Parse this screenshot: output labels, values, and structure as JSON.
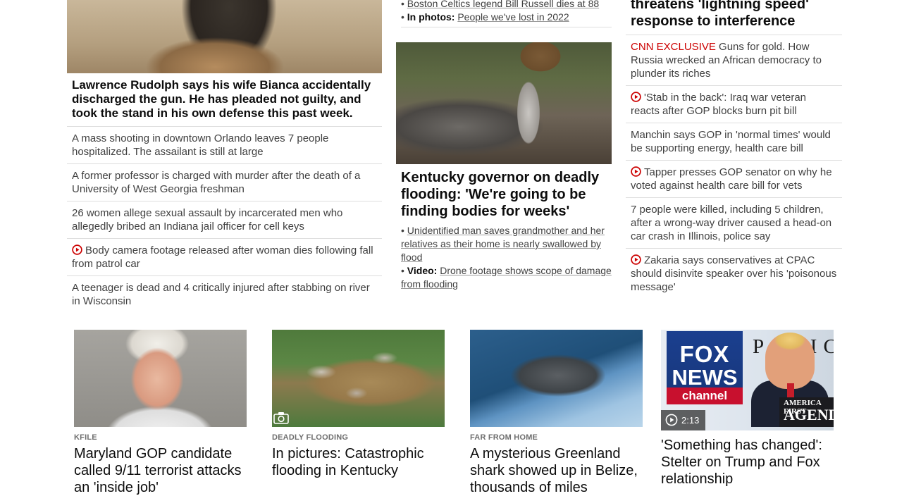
{
  "col1": {
    "lead_caption": "Lawrence Rudolph says his wife Bianca accidentally discharged the gun. He has pleaded not guilty, and took the stand in his own defense this past week.",
    "items": [
      {
        "text": "A mass shooting in downtown Orlando leaves 7 people hospitalized. The assailant is still at large",
        "video": false
      },
      {
        "text": "A former professor is charged with murder after the death of a University of West Georgia freshman",
        "video": false
      },
      {
        "text": "26 women allege sexual assault by incarcerated men who allegedly bribed an Indiana jail officer for cell keys",
        "video": false
      },
      {
        "text": "Body camera footage released after woman dies following fall from patrol car",
        "video": true
      },
      {
        "text": "A teenager is dead and 4 critically injured after stabbing on river in Wisconsin",
        "video": false
      }
    ]
  },
  "col2": {
    "top_bullets": [
      {
        "prefix": "",
        "text": "Boston Celtics legend Bill Russell dies at 88"
      },
      {
        "prefix": "In photos:",
        "text": "People we've lost in 2022"
      }
    ],
    "headline": "Kentucky governor on deadly flooding: 'We're going to be finding bodies for weeks'",
    "bullets": [
      {
        "prefix": "",
        "text": "Unidentified man saves grandmother and her relatives as their home is nearly swallowed by flood"
      },
      {
        "prefix": "Video:",
        "text": "Drone footage shows scope of damage from flooding"
      }
    ]
  },
  "col3": {
    "headline": "threatens 'lightning speed' response to interference",
    "items": [
      {
        "label": "CNN EXCLUSIVE",
        "text": "Guns for gold. How Russia wrecked an African democracy to plunder its riches",
        "video": false
      },
      {
        "label": "",
        "text": "'Stab in the back': Iraq war veteran reacts after GOP blocks burn pit bill",
        "video": true
      },
      {
        "label": "",
        "text": "Manchin says GOP in 'normal times' would be supporting energy, health care bill",
        "video": false
      },
      {
        "label": "",
        "text": "Tapper presses GOP senator on why he voted against health care bill for vets",
        "video": true
      },
      {
        "label": "",
        "text": "7 people were killed, including 5 children, after a wrong-way driver caused a head-on car crash in Illinois, police say",
        "video": false
      },
      {
        "label": "",
        "text": "Zakaria says conservatives at CPAC should disinvite speaker over his 'poisonous message'",
        "video": true
      }
    ]
  },
  "cards": [
    {
      "kicker": "KFILE",
      "title": "Maryland GOP candidate called 9/11 terrorist attacks an 'inside job'"
    },
    {
      "kicker": "DEADLY FLOODING",
      "title": "In pictures: Catastrophic flooding in Kentucky"
    },
    {
      "kicker": "FAR FROM HOME",
      "title": "A mysterious Greenland shark showed up in Belize, thousands of miles"
    },
    {
      "kicker": "",
      "title": "'Something has changed': Stelter on Trump and Fox relationship",
      "duration": "2:13"
    }
  ],
  "fox_image": {
    "logo_line1": "FOX",
    "logo_line2": "NEWS",
    "logo_line3": "channel",
    "backdrop_text": "POLIC",
    "sign_line1": "AMERICA FIRST",
    "sign_line2": "AGENDA"
  },
  "colors": {
    "accent_red": "#cc0000",
    "text_dark": "#0c0c0c",
    "text_body": "#404040",
    "divider": "#dedede"
  }
}
